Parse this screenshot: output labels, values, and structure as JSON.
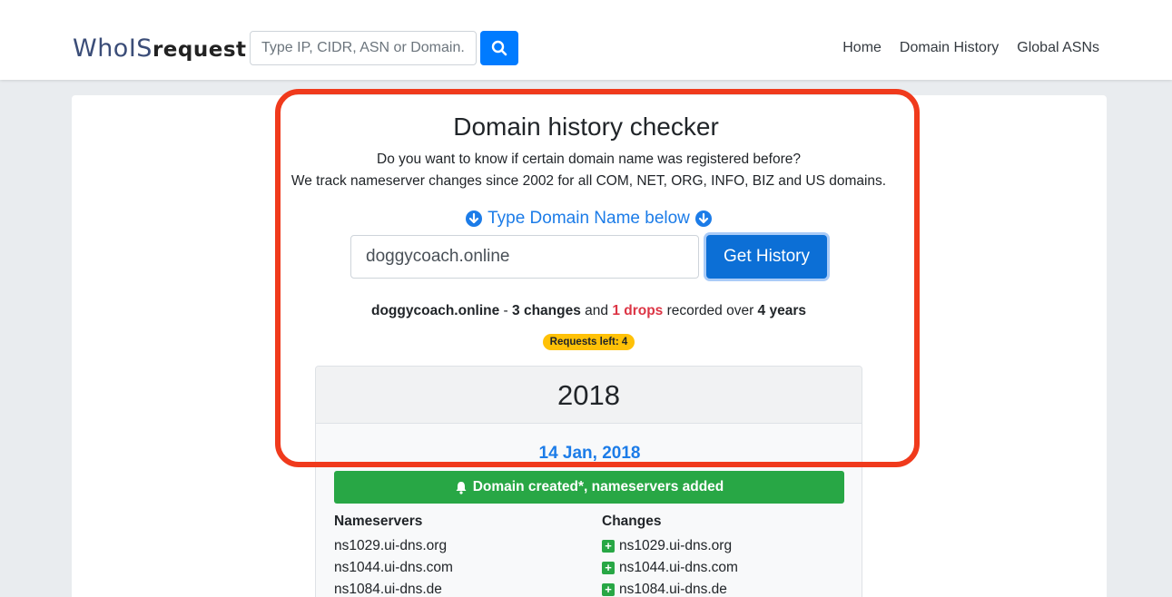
{
  "header": {
    "logo_part1": "WhoIS",
    "logo_part2": "request",
    "search_placeholder": "Type IP, CIDR, ASN or Domain..",
    "nav": [
      "Home",
      "Domain History",
      "Global ASNs"
    ]
  },
  "main": {
    "title": "Domain history checker",
    "desc_line1": "Do you want to know if certain domain name was registered before?",
    "desc_line2": "We track nameserver changes since 2002 for all COM, NET, ORG, INFO, BIZ and US domains.",
    "type_hint": "Type Domain Name below",
    "domain_value": "doggycoach.online",
    "button_label": "Get History",
    "summary": {
      "domain": "doggycoach.online",
      "sep": " - ",
      "changes": "3 changes",
      "and": " and ",
      "drops": "1 drops",
      "recorded": " recorded over ",
      "years": "4 years"
    },
    "badge": "Requests left: 4"
  },
  "history": {
    "year": "2018",
    "date": "14 Jan, 2018",
    "event": "Domain created*, nameservers added",
    "nameservers_header": "Nameservers",
    "changes_header": "Changes",
    "nameservers": [
      "ns1029.ui-dns.org",
      "ns1044.ui-dns.com",
      "ns1084.ui-dns.de"
    ],
    "changes": [
      "ns1029.ui-dns.org",
      "ns1044.ui-dns.com",
      "ns1084.ui-dns.de"
    ]
  },
  "colors": {
    "accent": "#007bff",
    "link_blue": "#1c7ce8",
    "success": "#28a745",
    "danger": "#dc3545",
    "badge": "#ffc107",
    "highlight": "#f03a1c"
  }
}
